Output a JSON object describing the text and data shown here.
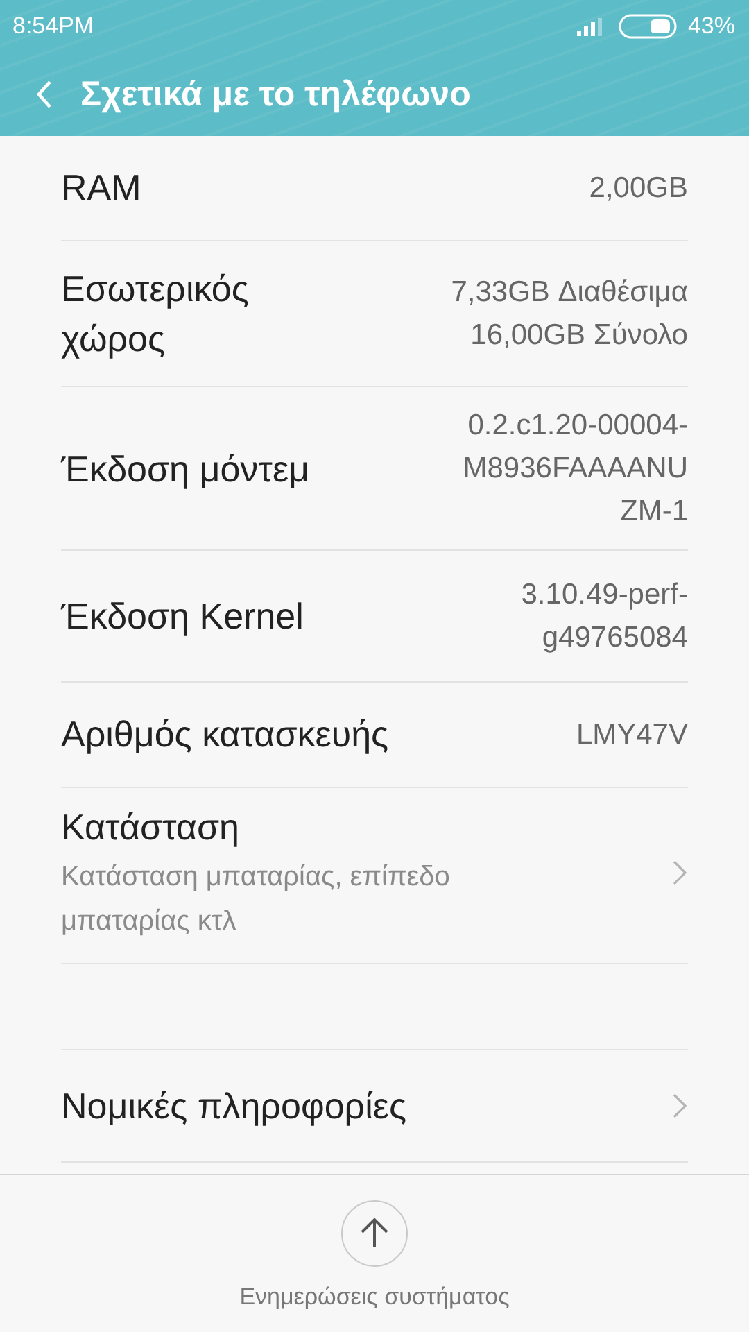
{
  "status_bar": {
    "time": "8:54PM",
    "battery": "43%"
  },
  "header": {
    "title": "Σχετικά με το τηλέφωνο"
  },
  "rows": [
    {
      "kind": "info",
      "label": "RAM",
      "value": [
        "2,00GB"
      ]
    },
    {
      "kind": "info",
      "label": "Εσωτερικός χώρος",
      "value": [
        "7,33GB Διαθέσιμα",
        "16,00GB Σύνολο"
      ]
    },
    {
      "kind": "info",
      "label": "Έκδοση μόντεμ",
      "value": [
        "0.2.c1.20-00004-",
        "M8936FAAAANU",
        "ZM-1"
      ]
    },
    {
      "kind": "info",
      "label": "Έκδοση Kernel",
      "value": [
        "3.10.49-perf-",
        "g49765084"
      ]
    },
    {
      "kind": "info",
      "label": "Αριθμός κατασκευής",
      "value": [
        "LMY47V"
      ]
    },
    {
      "kind": "nav",
      "label": "Κατάσταση",
      "subtitle": "Κατάσταση μπαταρίας, επίπεδο μπαταρίας κτλ"
    },
    {
      "kind": "gap"
    },
    {
      "kind": "nav",
      "label": "Νομικές πληροφορίες"
    }
  ],
  "footer": {
    "label": "Ενημερώσεις συστήματος"
  }
}
